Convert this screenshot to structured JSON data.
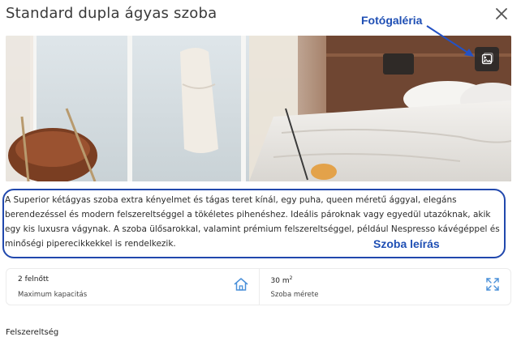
{
  "modal": {
    "title": "Standard dupla ágyas szoba",
    "close_icon": "close-icon"
  },
  "photo": {
    "gallery_icon": "image-gallery-icon"
  },
  "annotations": {
    "gallery": "Fotógaléria",
    "description": "Szoba leírás",
    "color": "#1f4fb4"
  },
  "description": "A Superior kétágyas szoba extra kényelmet és tágas teret kínál, egy puha, queen méretű ággyal, elegáns berendezéssel és modern felszereltséggel a tökéletes pihenéshez. Ideális pároknak vagy egyedül utazóknak, akik egy kis luxusra vágynak. A szoba ülősarokkal, valamint prémium felszereltséggel, például Nespresso kávégéppel és minőségi piperecikkekkel is rendelkezik.",
  "info": {
    "capacity": {
      "value": "2 felnőtt",
      "label": "Maximum kapacitás",
      "icon": "home-icon"
    },
    "size": {
      "value": "30 m",
      "unit_sup": "2",
      "label": "Szoba mérete",
      "icon": "expand-icon"
    }
  },
  "features_heading": "Felszereltség",
  "colors": {
    "accent": "#4a90d9",
    "annotation": "#1f4fb4"
  }
}
